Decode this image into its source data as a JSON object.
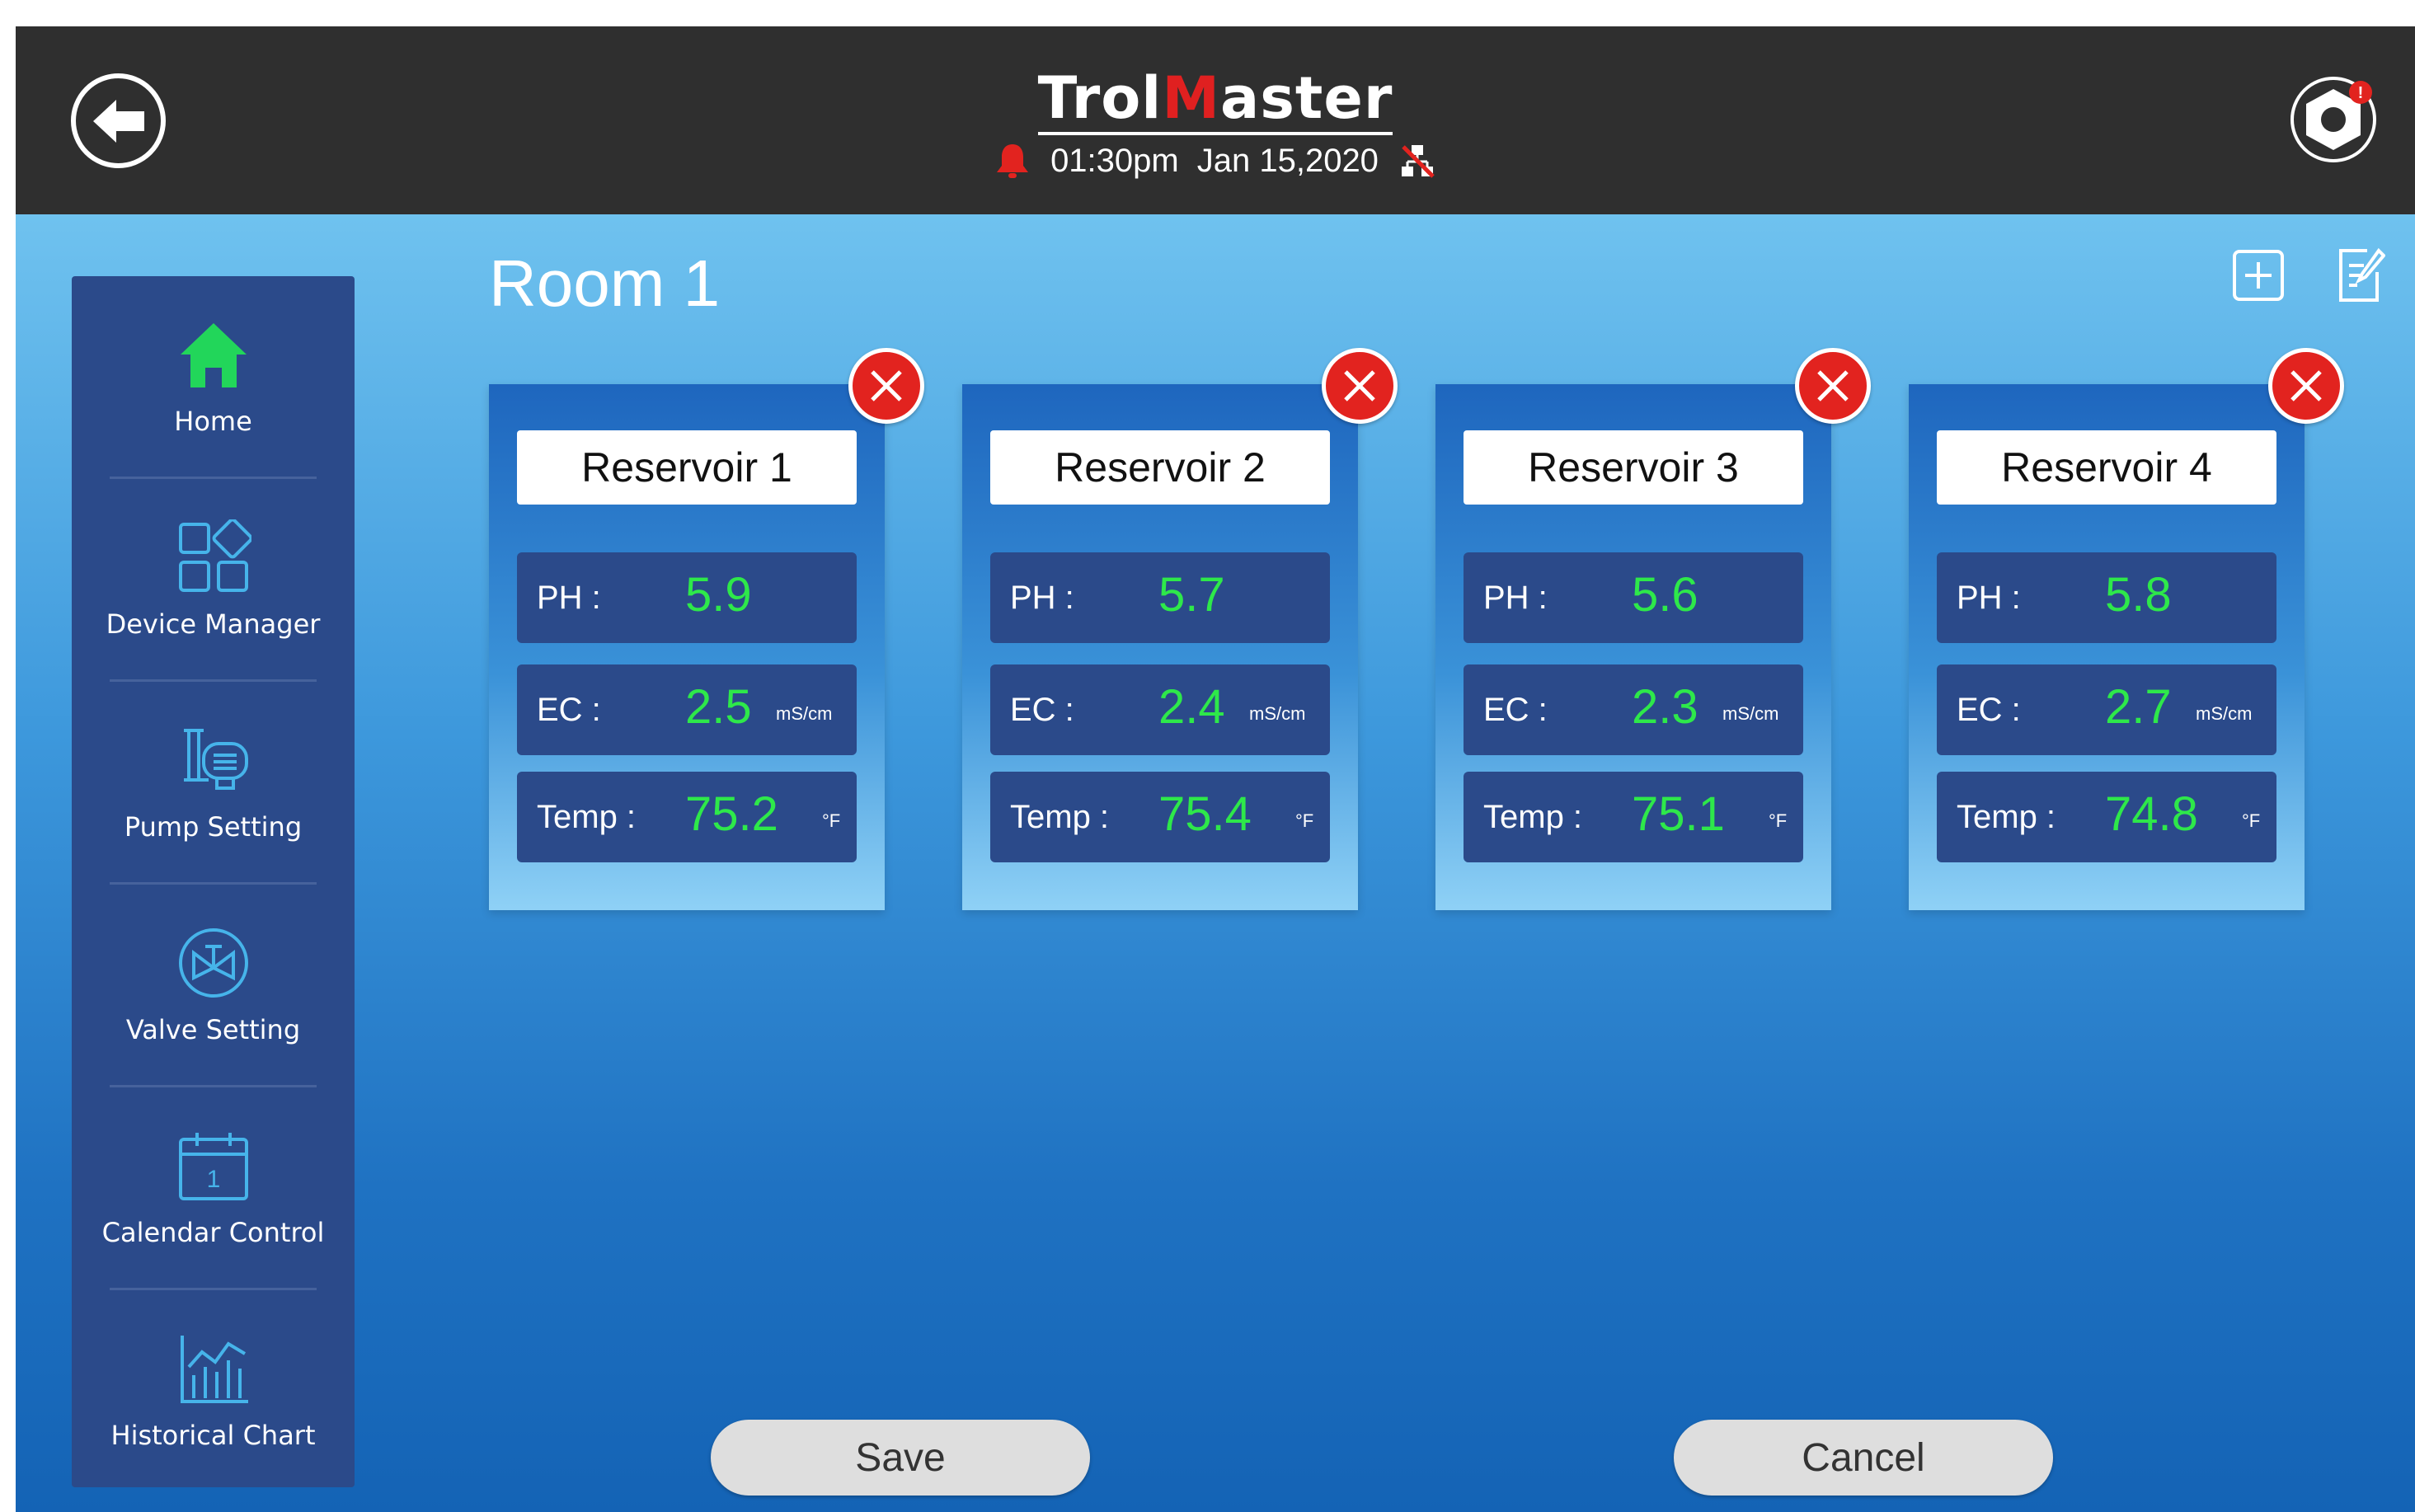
{
  "header": {
    "brand_left": "Trol",
    "brand_mid": "M",
    "brand_right": "aster",
    "time": "01:30pm",
    "date": "Jan 15,2020",
    "back_icon": "arrow-left-icon",
    "settings_icon": "gear-icon",
    "alert_color": "#e2231f"
  },
  "sidebar": {
    "items": [
      {
        "label": "Home",
        "icon": "home-icon",
        "color": "#22d65a"
      },
      {
        "label": "Device Manager",
        "icon": "device-grid-icon"
      },
      {
        "label": "Pump Setting",
        "icon": "pump-icon"
      },
      {
        "label": "Valve Setting",
        "icon": "valve-icon"
      },
      {
        "label": "Calendar Control",
        "icon": "calendar-icon",
        "calendar_day": "1"
      },
      {
        "label": "Historical Chart",
        "icon": "chart-icon"
      }
    ]
  },
  "room": {
    "title": "Room 1",
    "add_icon": "plus-box-icon",
    "edit_icon": "edit-document-icon"
  },
  "labels": {
    "ph": "PH :",
    "ec": "EC :",
    "temp": "Temp :",
    "ec_unit": "mS/cm",
    "temp_unit": "°F"
  },
  "reservoirs": [
    {
      "name": "Reservoir 1",
      "ph": "5.9",
      "ec": "2.5",
      "temp": "75.2"
    },
    {
      "name": "Reservoir 2",
      "ph": "5.7",
      "ec": "2.4",
      "temp": "75.4"
    },
    {
      "name": "Reservoir 3",
      "ph": "5.6",
      "ec": "2.3",
      "temp": "75.1"
    },
    {
      "name": "Reservoir 4",
      "ph": "5.8",
      "ec": "2.7",
      "temp": "74.8"
    }
  ],
  "actions": {
    "save": "Save",
    "cancel": "Cancel"
  },
  "colors": {
    "value_green": "#2ee84a",
    "panel_navy": "#2b4a8a",
    "delete_red": "#e2231f"
  }
}
